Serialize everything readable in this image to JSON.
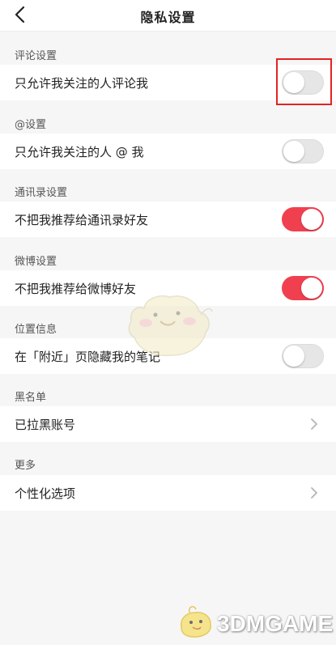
{
  "header": {
    "title": "隐私设置"
  },
  "sections": [
    {
      "title": "评论设置",
      "row": {
        "label": "只允许我关注的人评论我",
        "control": "toggle",
        "on": false,
        "highlighted": true
      }
    },
    {
      "title": "@设置",
      "row": {
        "label": "只允许我关注的人 @ 我",
        "control": "toggle",
        "on": false
      }
    },
    {
      "title": "通讯录设置",
      "row": {
        "label": "不把我推荐给通讯录好友",
        "control": "toggle",
        "on": true
      }
    },
    {
      "title": "微博设置",
      "row": {
        "label": "不把我推荐给微博好友",
        "control": "toggle",
        "on": true
      }
    },
    {
      "title": "位置信息",
      "row": {
        "label": "在「附近」页隐藏我的笔记",
        "control": "toggle",
        "on": false
      }
    },
    {
      "title": "黑名单",
      "row": {
        "label": "已拉黑账号",
        "control": "chevron"
      }
    },
    {
      "title": "更多",
      "row": {
        "label": "个性化选项",
        "control": "chevron"
      }
    }
  ],
  "colors": {
    "toggle_on": "#f0404f",
    "toggle_off": "#e6e6e6",
    "highlight": "#e62222",
    "background": "#f6f6f6"
  },
  "watermark": {
    "text": "3DMGAME"
  },
  "icons": {
    "back": "chevron-left-icon",
    "row_arrow": "chevron-right-icon"
  }
}
